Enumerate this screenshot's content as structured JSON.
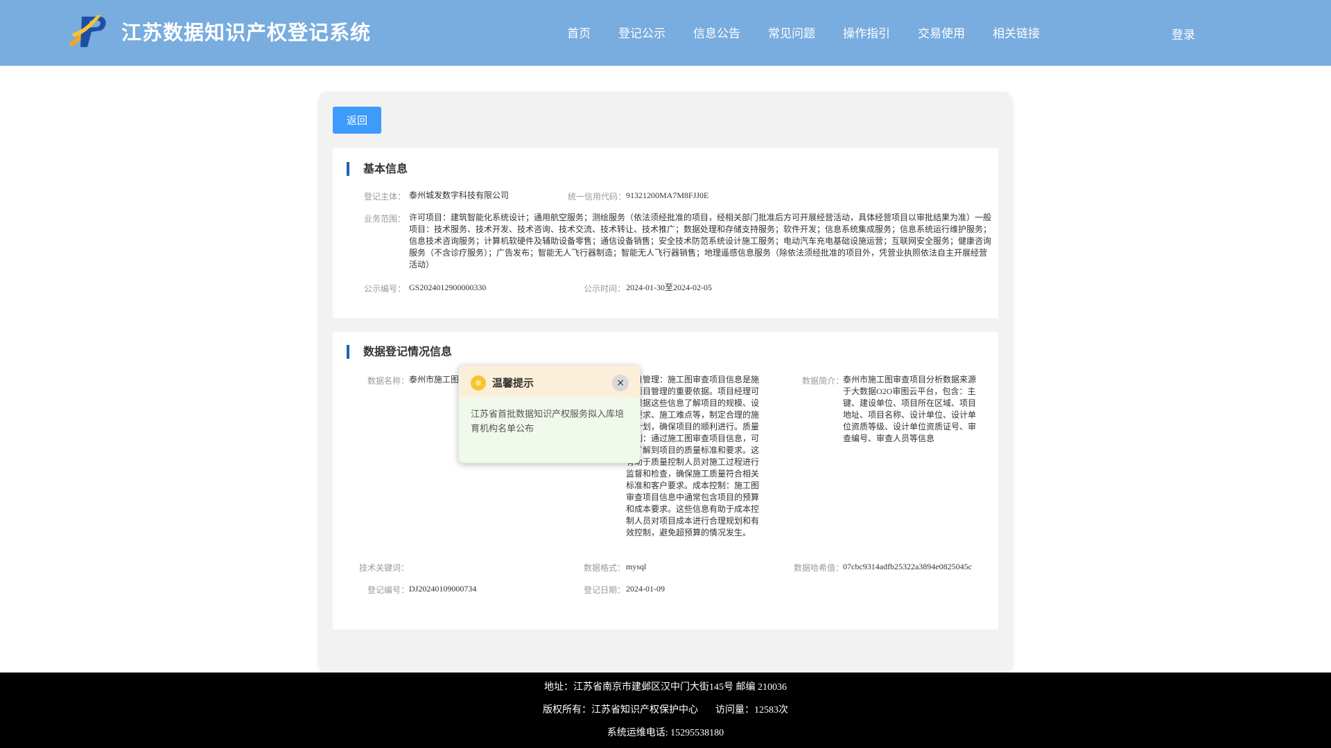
{
  "header": {
    "title": "江苏数据知识产权登记系统",
    "nav": [
      "首页",
      "登记公示",
      "信息公告",
      "常见问题",
      "操作指引",
      "交易使用",
      "相关链接"
    ],
    "login": "登录"
  },
  "back_button": "返回",
  "basic": {
    "title": "基本信息",
    "registrant_label": "登记主体：",
    "registrant": "泰州城发数字科技有限公司",
    "credit_code_label": "统一信用代码：",
    "credit_code": "91321200MA7M8FJJ0E",
    "scope_label": "业务范围：",
    "scope": "许可项目：建筑智能化系统设计；通用航空服务；测绘服务（依法须经批准的项目，经相关部门批准后方可开展经营活动，具体经营项目以审批结果为准）一般项目：技术服务、技术开发、技术咨询、技术交流、技术转让、技术推广；数据处理和存储支持服务；软件开发；信息系统集成服务；信息系统运行维护服务；信息技术咨询服务；计算机软硬件及辅助设备零售；通信设备销售；安全技术防范系统设计施工服务；电动汽车充电基础设施运营；互联网安全服务；健康咨询服务（不含诊疗服务）；广告发布；智能无人飞行器制造；智能无人飞行器销售；地理遥感信息服务（除依法须经批准的项目外，凭营业执照依法自主开展经营活动）",
    "pub_no_label": "公示编号：",
    "pub_no": "GS2024012900000330",
    "pub_time_label": "公示时间：",
    "pub_time": "2024-01-30至2024-02-05"
  },
  "data_info": {
    "title": "数据登记情况信息",
    "name_label": "数据名称：",
    "name": "泰州市施工图",
    "scene_text": "项目管理：施工图审查项目信息是施工项目管理的重要依据。项目经理可以根据这些信息了解项目的规模、设计要求、施工难点等，制定合理的施工计划，确保项目的顺利进行。质量控制：通过施工图审查项目信息，可以了解到项目的质量标准和要求。这有助于质量控制人员对施工过程进行监督和检查，确保施工质量符合相关标准和客户要求。成本控制：施工图审查项目信息中通常包含项目的预算和成本要求。这些信息有助于成本控制人员对项目成本进行合理规划和有效控制，避免超预算的情况发生。",
    "intro_label": "数据简介：",
    "intro": "泰州市施工图审查项目分析数据来源于大数据O2O审图云平台，包含：主键、建设单位、项目所在区域、项目地址、项目名称、设计单位、设计单位资质等级、设计单位资质证号、审查编号、审查人员等信息",
    "keywords_label": "技术关键词：",
    "keywords": "",
    "format_label": "数据格式：",
    "format": "mysql",
    "hash_label": "数据哈希值：",
    "hash": "07cbc9314adfb25322a3894e0825045c",
    "reg_no_label": "登记编号：",
    "reg_no": "DJ20240109000734",
    "reg_date_label": "登记日期：",
    "reg_date": "2024-01-09"
  },
  "modal": {
    "title": "温馨提示",
    "close": "×",
    "body": "江苏省首批数据知识产权服务拟入库培育机构名单公布"
  },
  "footer": {
    "address": "地址：江苏省南京市建邺区汉中门大街145号 邮编 210036",
    "copyright": "版权所有：江苏省知识产权保护中心",
    "visits": "访问量：12583次",
    "phone": "系统运维电话: 15295538180"
  }
}
